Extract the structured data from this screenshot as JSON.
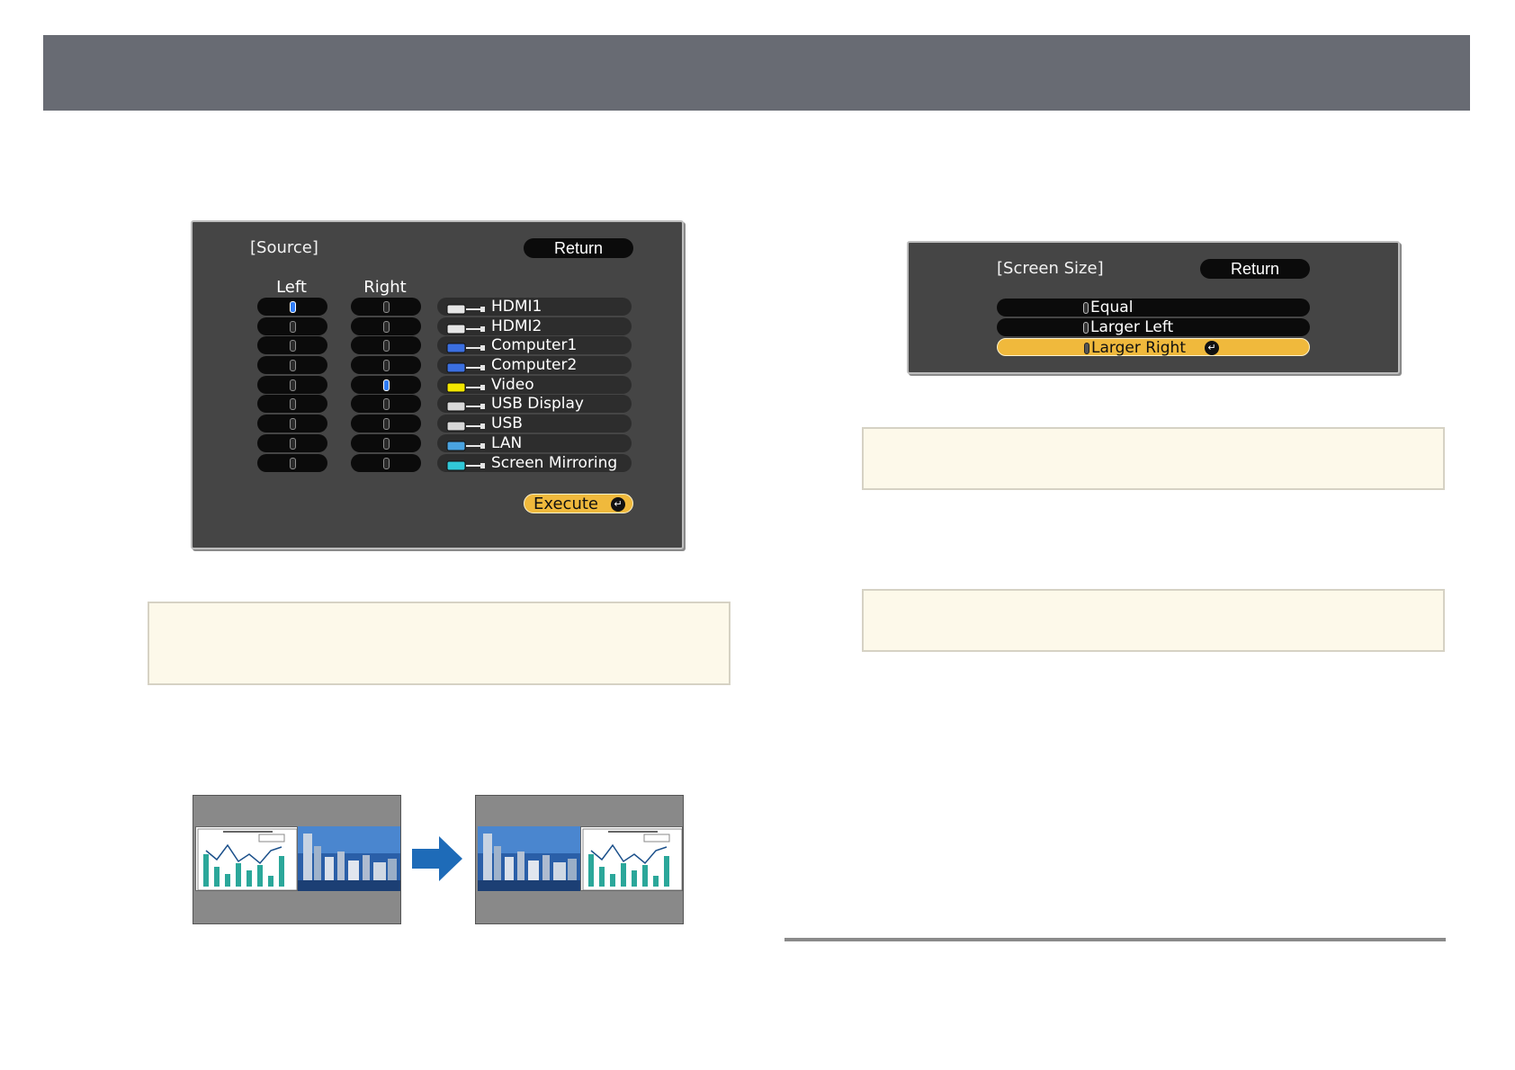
{
  "source_menu": {
    "title": "[Source]",
    "return_label": "Return",
    "left_header": "Left",
    "right_header": "Right",
    "sources": [
      {
        "label": "HDMI1",
        "icon": "hdmi-icon"
      },
      {
        "label": "HDMI2",
        "icon": "hdmi-icon"
      },
      {
        "label": "Computer1",
        "icon": "computer-port-icon"
      },
      {
        "label": "Computer2",
        "icon": "computer-port-icon"
      },
      {
        "label": "Video",
        "icon": "video-rca-icon"
      },
      {
        "label": "USB Display",
        "icon": "usb-display-icon"
      },
      {
        "label": "USB",
        "icon": "usb-icon"
      },
      {
        "label": "LAN",
        "icon": "lan-wireless-icon"
      },
      {
        "label": "Screen Mirroring",
        "icon": "screen-mirroring-icon"
      }
    ],
    "left_selected": "HDMI1",
    "right_selected": "Video",
    "execute_label": "Execute"
  },
  "screen_size_menu": {
    "title": "[Screen Size]",
    "return_label": "Return",
    "options": [
      "Equal",
      "Larger Left",
      "Larger Right"
    ],
    "selected": "Larger Right"
  },
  "colors": {
    "header_bar": "#686b73",
    "menu_bg": "#454545",
    "highlight": "#f0b93c",
    "radio_on": "#2f7cf6",
    "note_bg": "#fdf9ea",
    "arrow": "#1e6bb8"
  }
}
